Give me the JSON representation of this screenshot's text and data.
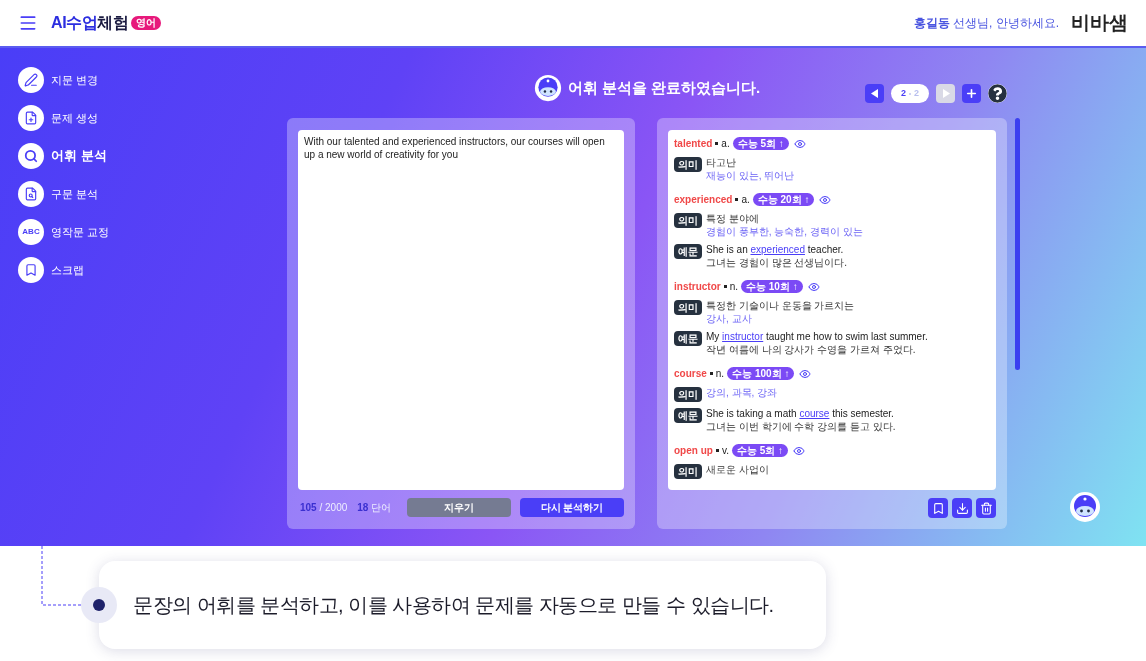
{
  "header": {
    "logo": {
      "primary": "AI수업",
      "secondary": "체험",
      "badge": "영어"
    },
    "greeting": "**홍길동** 선생님, 안녕하세요.",
    "brand": "비바샘"
  },
  "sidebar": {
    "items": [
      {
        "label": "지문 변경",
        "kind": "edit",
        "selected": false
      },
      {
        "label": "문제 생성",
        "kind": "create",
        "selected": false
      },
      {
        "label": "어휘 분석",
        "kind": "search",
        "selected": true
      },
      {
        "label": "구문 분석",
        "kind": "syntax",
        "selected": false
      },
      {
        "label": "영작문 교정",
        "kind": "abc",
        "icon_text": "ABC",
        "selected": false
      },
      {
        "label": "스크랩",
        "kind": "scrap",
        "selected": false
      }
    ]
  },
  "title": "어휘 분석을 완료하였습니다.",
  "pager": {
    "current": "2",
    "total": "2",
    "prev_disabled": false,
    "next_disabled": true
  },
  "input": {
    "value": "With our talented and experienced instructors, our courses will open up a new world of creativity for you",
    "char_count": "105",
    "char_limit": "/ 2000",
    "word_count": "18",
    "word_unit": "단어",
    "clear_button": "지우기",
    "analyze_button": "다시 분석하기"
  },
  "entries": [
    {
      "word": "talented",
      "pos": "a.",
      "badge": "수능 5회 ↑",
      "meanings": [
        {
          "label": "의미",
          "context": "타고난",
          "translation": "재능이 있는, 뛰어난"
        }
      ]
    },
    {
      "word": "experienced",
      "pos": "a.",
      "badge": "수능 20회 ↑",
      "meanings": [
        {
          "label": "의미",
          "context": "특정 분야에",
          "translation": "경험이 풍부한, 능숙한, 경력이 있는"
        }
      ],
      "examples": [
        {
          "label": "예문",
          "before": "She is an ",
          "link": "experienced",
          "after": " teacher.",
          "translation": "그녀는 경험이 많은 선생님이다."
        }
      ]
    },
    {
      "word": "instructor",
      "pos": "n.",
      "badge": "수능 10회 ↑",
      "meanings": [
        {
          "label": "의미",
          "context": "특정한 기술이나 운동을 가르치는",
          "translation": "강사, 교사"
        }
      ],
      "examples": [
        {
          "label": "예문",
          "before": "My ",
          "link": "instructor",
          "after": " taught me how to swim last summer.",
          "translation": "작년 여름에 나의 강사가 수영을 가르쳐 주었다."
        }
      ]
    },
    {
      "word": "course",
      "pos": "n.",
      "badge": "수능 100회 ↑",
      "meanings": [
        {
          "label": "의미",
          "translation": "강의, 과목, 강좌"
        }
      ],
      "examples": [
        {
          "label": "예문",
          "before": "She is taking a math ",
          "link": "course",
          "after": " this semester.",
          "translation": "그녀는 이번 학기에 수학 강의를 듣고 있다."
        }
      ]
    },
    {
      "word": "open up",
      "pos": "v.",
      "badge": "수능 5회 ↑",
      "meanings": [
        {
          "label": "의미",
          "context": "새로운 사업이"
        }
      ]
    }
  ],
  "callout": "문장의 어휘를 분석하고, 이를 사용하여 문제를 자동으로 만들 수 있습니다."
}
